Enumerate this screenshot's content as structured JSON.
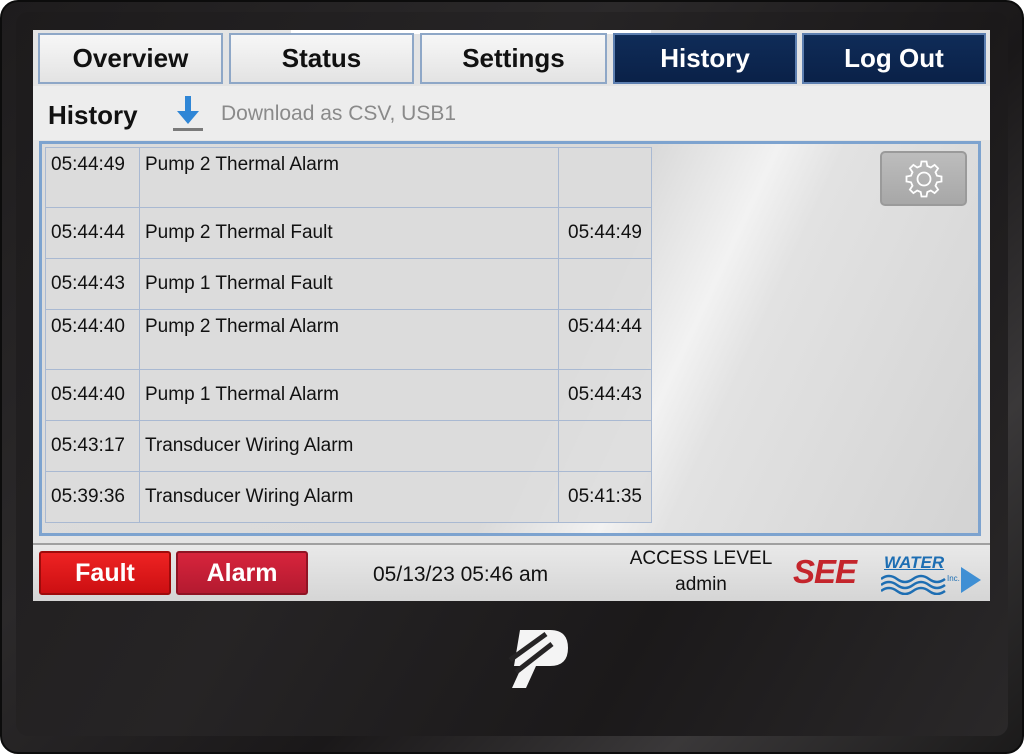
{
  "tabs": [
    {
      "label": "Overview",
      "active": false
    },
    {
      "label": "Status",
      "active": false
    },
    {
      "label": "Settings",
      "active": false
    },
    {
      "label": "History",
      "active": true
    },
    {
      "label": "Log Out",
      "active": false
    }
  ],
  "history": {
    "title": "History",
    "download_icon": "download-arrow-icon",
    "download_label": "Download as CSV, USB1",
    "rows": [
      {
        "time": "05:44:49",
        "event": "Pump 2 Thermal Alarm",
        "cleared": ""
      },
      {
        "time": "05:44:44",
        "event": "Pump 2 Thermal Fault",
        "cleared": "05:44:49"
      },
      {
        "time": "05:44:43",
        "event": "Pump 1 Thermal Fault",
        "cleared": ""
      },
      {
        "time": "05:44:40",
        "event": "Pump 2 Thermal Alarm",
        "cleared": "05:44:44"
      },
      {
        "time": "05:44:40",
        "event": "Pump 1 Thermal Alarm",
        "cleared": "05:44:43"
      },
      {
        "time": "05:43:17",
        "event": "Transducer Wiring Alarm",
        "cleared": ""
      },
      {
        "time": "05:39:36",
        "event": "Transducer Wiring Alarm",
        "cleared": "05:41:35"
      }
    ],
    "settings_icon": "gear-icon"
  },
  "statusbar": {
    "fault_label": "Fault",
    "alarm_label": "Alarm",
    "datetime": "05/13/23 05:46 am",
    "access_label": "ACCESS LEVEL",
    "access_user": "admin",
    "logo_see": "SEE",
    "logo_water": "WATER",
    "logo_inc": "Inc."
  },
  "colors": {
    "active_tab": "#0f2c58",
    "fault": "#e31b1e",
    "alarm": "#c41f36",
    "panel_border": "#7da3cf",
    "logo_red": "#c4252c",
    "logo_blue": "#1d6eb3"
  }
}
